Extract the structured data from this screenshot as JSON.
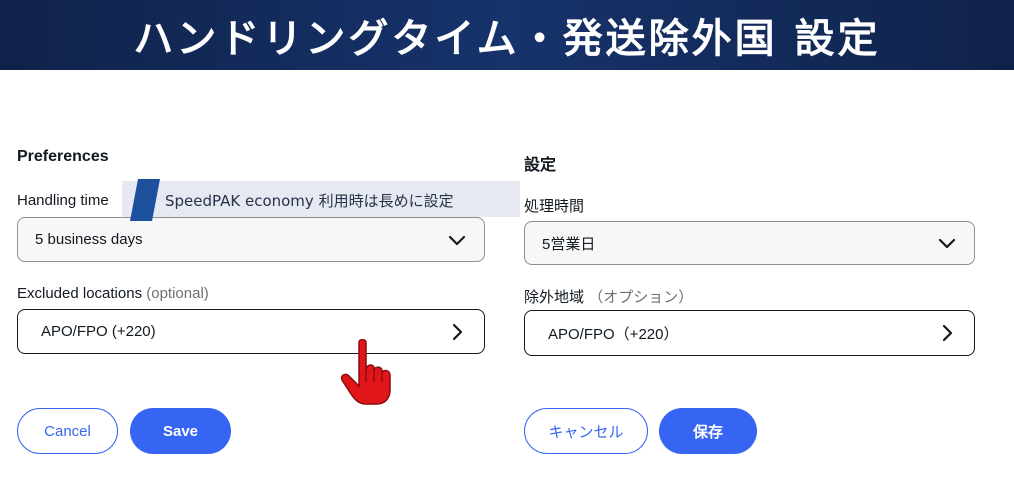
{
  "banner": {
    "title": "ハンドリングタイム・発送除外国 設定"
  },
  "left_panel": {
    "heading": "Preferences",
    "handling_label": "Handling time",
    "handling_value": "5 business days",
    "excluded_label": "Excluded locations",
    "excluded_optional": "(optional)",
    "excluded_value": "APO/FPO (+220)",
    "cancel_label": "Cancel",
    "save_label": "Save"
  },
  "right_panel": {
    "heading": "設定",
    "handling_label": "処理時間",
    "handling_value": "5営業日",
    "excluded_label": "除外地域",
    "excluded_optional": "（オプション）",
    "excluded_value": "APO/FPO（+220）",
    "cancel_label": "キャンセル",
    "save_label": "保存"
  },
  "tooltip": {
    "text": "SpeedPAK economy 利用時は長めに設定"
  },
  "icons": {
    "chevron_down": "chevron-down-icon",
    "chevron_right": "chevron-right-icon",
    "pointer_hand": "pointer-hand-icon"
  },
  "colors": {
    "banner": "#0f2249",
    "accent": "#3665f3",
    "hand": "#e0161b"
  }
}
